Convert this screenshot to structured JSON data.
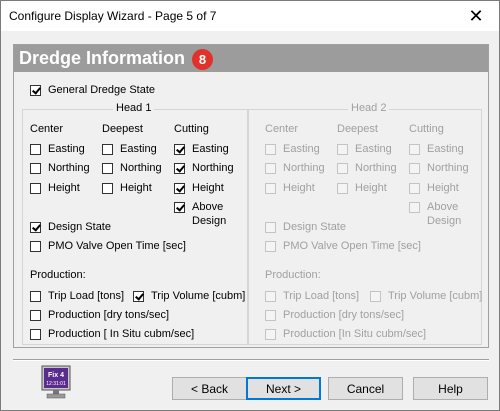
{
  "window": {
    "title": "Configure Display Wizard - Page 5 of 7"
  },
  "header": {
    "title": "Dredge Information",
    "badge": "8"
  },
  "general": {
    "label": "General Dredge State",
    "checked": true
  },
  "head1": {
    "legend": "Head 1",
    "columns": [
      "Center",
      "Deepest",
      "Cutting"
    ],
    "center": [
      {
        "label": "Easting",
        "checked": false
      },
      {
        "label": "Northing",
        "checked": false
      },
      {
        "label": "Height",
        "checked": false
      }
    ],
    "deepest": [
      {
        "label": "Easting",
        "checked": false
      },
      {
        "label": "Northing",
        "checked": false
      },
      {
        "label": "Height",
        "checked": false
      }
    ],
    "cutting": [
      {
        "label": "Easting",
        "checked": true
      },
      {
        "label": "Northing",
        "checked": true
      },
      {
        "label": "Height",
        "checked": true
      },
      {
        "label": "Above",
        "label2": "Design",
        "checked": true
      }
    ],
    "design_state": {
      "label": "Design State",
      "checked": true
    },
    "pmo": {
      "label": "PMO Valve Open Time [sec]",
      "checked": false
    },
    "production_label": "Production:",
    "trip_load": {
      "label": "Trip Load [tons]",
      "checked": false
    },
    "trip_volume": {
      "label": "Trip Volume [cubm]",
      "checked": true
    },
    "production_dry": {
      "label": "Production [dry tons/sec]",
      "checked": false
    },
    "production_insitu": {
      "label": "Production [ In Situ cubm/sec]",
      "checked": false
    }
  },
  "head2": {
    "legend": "Head 2",
    "columns": [
      "Center",
      "Deepest",
      "Cutting"
    ],
    "center": [
      {
        "label": "Easting"
      },
      {
        "label": "Northing"
      },
      {
        "label": "Height"
      }
    ],
    "deepest": [
      {
        "label": "Easting"
      },
      {
        "label": "Northing"
      },
      {
        "label": "Height"
      }
    ],
    "cutting": [
      {
        "label": "Easting"
      },
      {
        "label": "Northing"
      },
      {
        "label": "Height"
      },
      {
        "label": "Above",
        "label2": "Design"
      }
    ],
    "design_state": {
      "label": "Design State"
    },
    "pmo": {
      "label": "PMO Valve Open Time [sec]"
    },
    "production_label": "Production:",
    "trip_load": {
      "label": "Trip Load [tons]"
    },
    "trip_volume": {
      "label": "Trip Volume [cubm]"
    },
    "production_dry": {
      "label": "Production [dry tons/sec]"
    },
    "production_insitu": {
      "label": "Production [In Situ cubm/sec]"
    }
  },
  "logo": {
    "line1": "Fix 4",
    "line2": "12:31:01"
  },
  "buttons": {
    "back": "< Back",
    "next": "Next >",
    "cancel": "Cancel",
    "help": "Help"
  },
  "colors": {
    "header_bar": "#9c9c9c",
    "badge": "#e0322b",
    "default_button_border": "#0078d7"
  }
}
